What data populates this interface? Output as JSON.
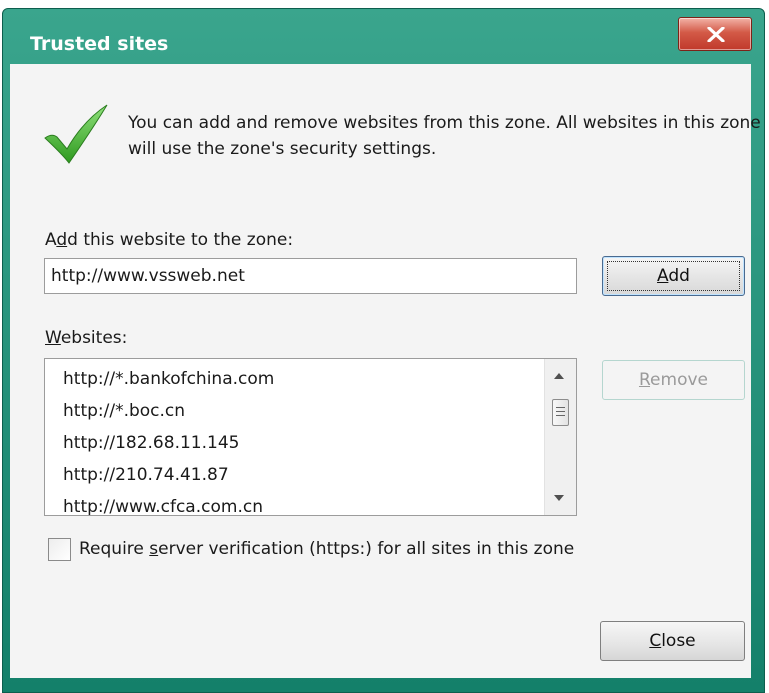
{
  "dialog": {
    "title": "Trusted sites",
    "info_text": "You can add and remove websites from this zone. All websites in this zone will use the zone's security settings."
  },
  "add_section": {
    "label_pre": "A",
    "label_accel": "d",
    "label_post": "d this website to the zone:",
    "input_value": "http://www.vssweb.net",
    "add_button_accel": "A",
    "add_button_rest": "dd"
  },
  "websites_section": {
    "label_accel": "W",
    "label_rest": "ebsites:",
    "items": [
      "http://*.bankofchina.com",
      "http://*.boc.cn",
      "http://182.68.11.145",
      "http://210.74.41.87",
      "http://www.cfca.com.cn"
    ],
    "remove_button_accel": "R",
    "remove_button_rest": "emove"
  },
  "verification": {
    "checked": false,
    "label_pre": "Require ",
    "label_accel": "s",
    "label_post": "erver verification (https:) for all sites in this zone"
  },
  "footer": {
    "close_accel": "C",
    "close_rest": "lose"
  },
  "icons": [
    "close-x-icon",
    "checkmark-icon",
    "scroll-up-arrow-icon",
    "scroll-down-arrow-icon",
    "scrollbar-thumb-icon"
  ],
  "colors": {
    "frame": "#14806a",
    "close_button": "#c0392b",
    "checkmark": "#3fae29"
  }
}
